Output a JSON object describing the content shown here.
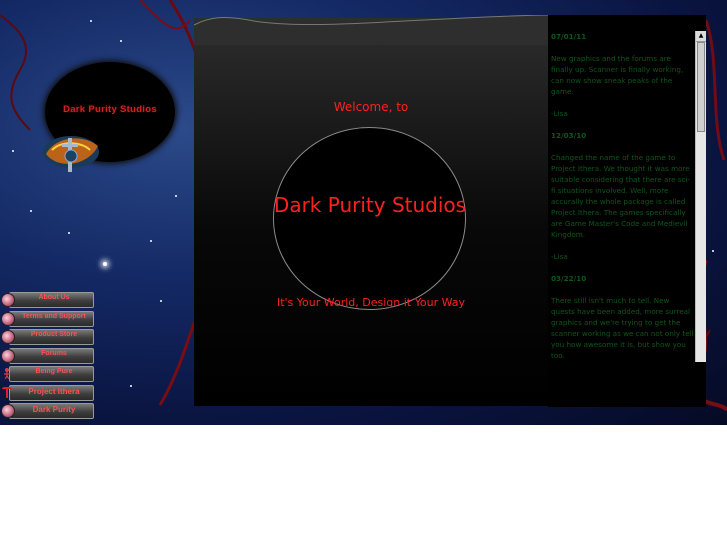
{
  "logo": {
    "title": "Dark Purity Studios"
  },
  "nav": {
    "items": [
      {
        "label": "About Us",
        "icon": "orb-icon"
      },
      {
        "label": "Terms and Support",
        "icon": "orb-icon"
      },
      {
        "label": "Product Store",
        "icon": "orb-icon"
      },
      {
        "label": "Forums",
        "icon": "orb-icon"
      },
      {
        "label": "Being Pure",
        "icon": "figure-icon"
      },
      {
        "label": "Project Ithera",
        "icon": "tower-icon"
      },
      {
        "label": "Dark Purity",
        "icon": "orb-icon"
      }
    ]
  },
  "main": {
    "welcome": "Welcome, to",
    "brand": "Dark Purity Studios",
    "tagline": "It's Your World, Design it Your Way"
  },
  "news": {
    "entries": [
      {
        "date": "07/01/11",
        "paragraphs": [
          "New graphics and the forums are finally up. Scanner is finally working, can now show sneak peaks of the game.",
          "-Lisa"
        ]
      },
      {
        "date": "12/03/10",
        "paragraphs": [
          "Changed the name of the game to Project Ithera. We thought it was more suitable considering that there are sci-fi situations involved. Well, more accurally the whole package is called Project Ithera. The games specifically are Game Master's Code and Medievil Kingdom.",
          "-Lisa"
        ]
      },
      {
        "date": "03/22/10",
        "paragraphs": [
          "There still isn't much to tell. New quests have been added, more surreal graphics and we're trying to get the scanner working as we can not only tell you how awesome it is, but show you too."
        ]
      }
    ]
  },
  "colors": {
    "accent": "#ff2020",
    "news_text": "#10561a",
    "nav_text": "#ff5050"
  }
}
